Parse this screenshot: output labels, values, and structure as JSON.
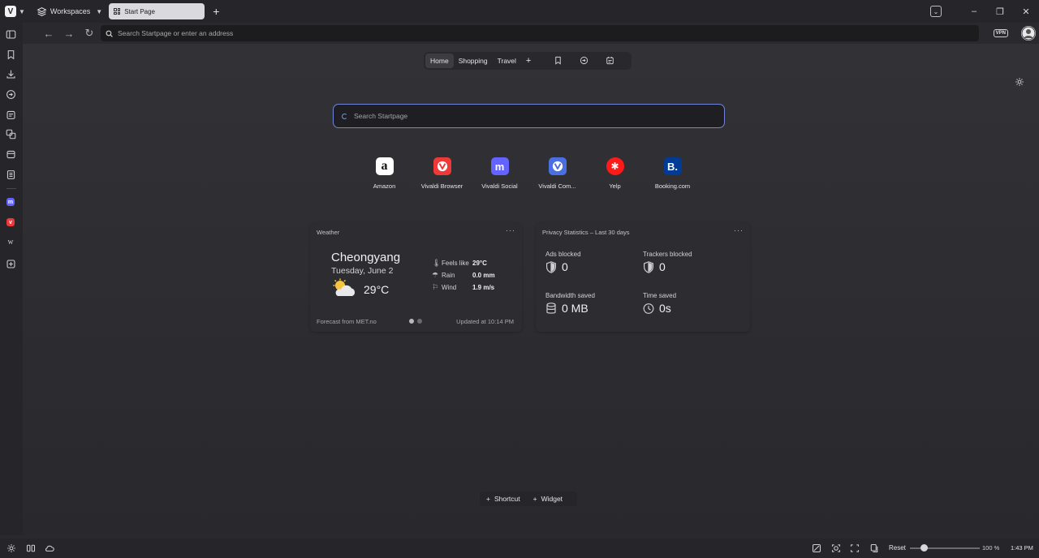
{
  "tabbar": {
    "workspaces_label": "Workspaces",
    "active_tab_title": "Start Page"
  },
  "addressbar": {
    "placeholder": "Search Startpage or enter an address",
    "vpn_label": "VPN"
  },
  "startpage_nav": {
    "items": [
      {
        "label": "Home",
        "active": true
      },
      {
        "label": "Shopping",
        "active": false
      },
      {
        "label": "Travel",
        "active": false
      }
    ],
    "add_label": "+"
  },
  "search": {
    "placeholder": "Search Startpage"
  },
  "speed_dials": [
    {
      "label": "Amazon",
      "icon": "amazon-icon",
      "color": "#ffffff"
    },
    {
      "label": "Vivaldi Browser",
      "icon": "vivaldi-icon",
      "color": "#ef3939"
    },
    {
      "label": "Vivaldi Social",
      "icon": "mastodon-icon",
      "color": "#6364ff"
    },
    {
      "label": "Vivaldi Com...",
      "icon": "vivaldi-icon",
      "color": "#4a6fe3"
    },
    {
      "label": "Yelp",
      "icon": "yelp-icon",
      "color": "#ff1a1a"
    },
    {
      "label": "Booking.com",
      "icon": "booking-icon",
      "color": "#003b95"
    }
  ],
  "weather": {
    "title": "Weather",
    "city": "Cheongyang",
    "date": "Tuesday, June 2",
    "temperature": "29°C",
    "feels_like_label": "Feels like",
    "feels_like": "29°C",
    "rain_label": "Rain",
    "rain": "0.0 mm",
    "wind_label": "Wind",
    "wind": "1.9 m/s",
    "forecast_source": "Forecast from MET.no",
    "updated": "Updated at 10:14 PM",
    "menu": "···"
  },
  "privacy": {
    "title": "Privacy Statistics – Last 30 days",
    "menu": "···",
    "ads_blocked_label": "Ads blocked",
    "ads_blocked": "0",
    "trackers_blocked_label": "Trackers blocked",
    "trackers_blocked": "0",
    "bandwidth_label": "Bandwidth saved",
    "bandwidth": "0 MB",
    "time_label": "Time saved",
    "time": "0s"
  },
  "bottom_actions": {
    "shortcut_label": "Shortcut",
    "widget_label": "Widget"
  },
  "statusbar": {
    "reset_label": "Reset",
    "zoom": "100 %",
    "zoom_fraction": 0.2,
    "clock": "1:43 PM"
  },
  "colors": {
    "accent": "#6f85d8",
    "background": "#2a2a2e"
  }
}
